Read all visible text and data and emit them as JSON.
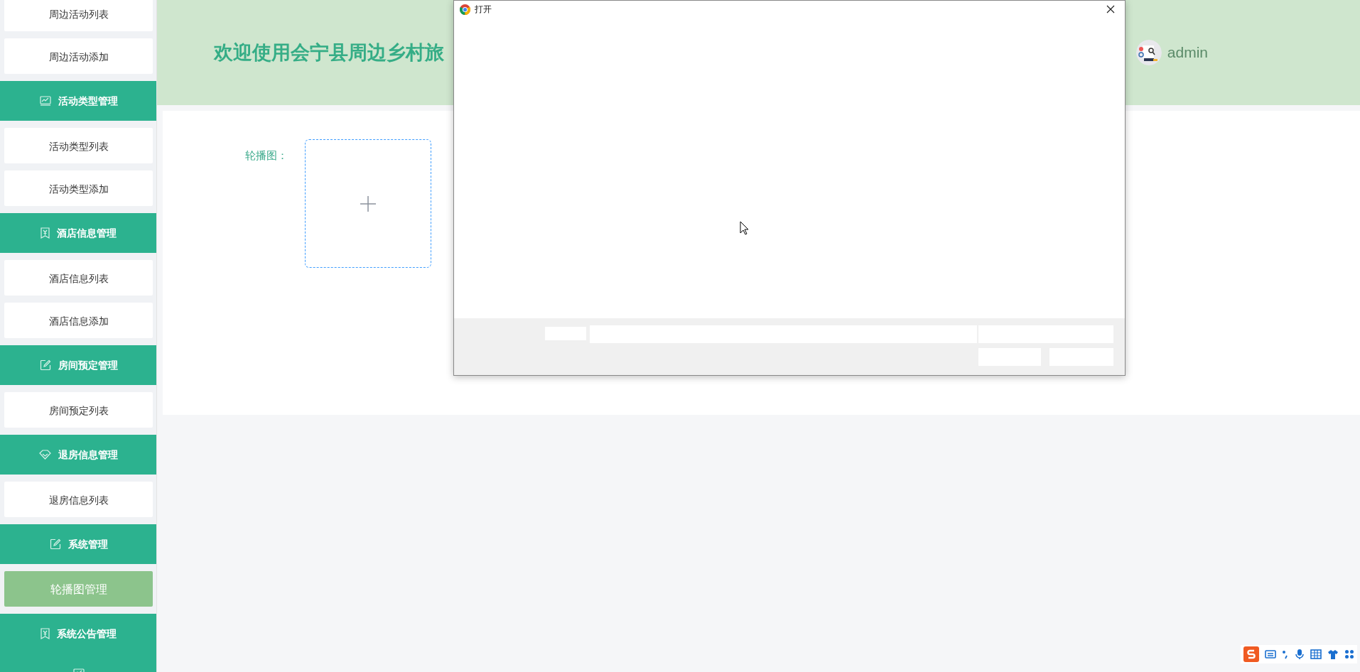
{
  "sidebar": {
    "items": [
      {
        "kind": "link",
        "label": "周边活动列表",
        "selected": false
      },
      {
        "kind": "link",
        "label": "周边活动添加",
        "selected": false
      },
      {
        "kind": "group",
        "label": "活动类型管理",
        "icon": {
          "kind": "chart"
        }
      },
      {
        "kind": "link",
        "label": "活动类型列表",
        "selected": false
      },
      {
        "kind": "link",
        "label": "活动类型添加",
        "selected": false
      },
      {
        "kind": "group",
        "label": "酒店信息管理",
        "icon": {
          "kind": "receipt"
        }
      },
      {
        "kind": "link",
        "label": "酒店信息列表",
        "selected": false
      },
      {
        "kind": "link",
        "label": "酒店信息添加",
        "selected": false
      },
      {
        "kind": "group",
        "label": "房间预定管理",
        "icon": {
          "kind": "edit"
        }
      },
      {
        "kind": "link",
        "label": "房间预定列表",
        "selected": false
      },
      {
        "kind": "group",
        "label": "退房信息管理",
        "icon": {
          "kind": "tag"
        }
      },
      {
        "kind": "link",
        "label": "退房信息列表",
        "selected": false
      },
      {
        "kind": "group",
        "label": "系统管理",
        "icon": {
          "kind": "edit"
        }
      },
      {
        "kind": "link",
        "label": "轮播图管理",
        "selected": true
      },
      {
        "kind": "group",
        "label": "系统公告管理",
        "icon": {
          "kind": "receipt"
        }
      },
      {
        "kind": "group",
        "icon": {
          "kind": "chart"
        }
      }
    ]
  },
  "header": {
    "title": "欢迎使用会宁县周边乡村旅",
    "user": "admin"
  },
  "form": {
    "label": "轮播图："
  },
  "dialog": {
    "title": "打开"
  }
}
